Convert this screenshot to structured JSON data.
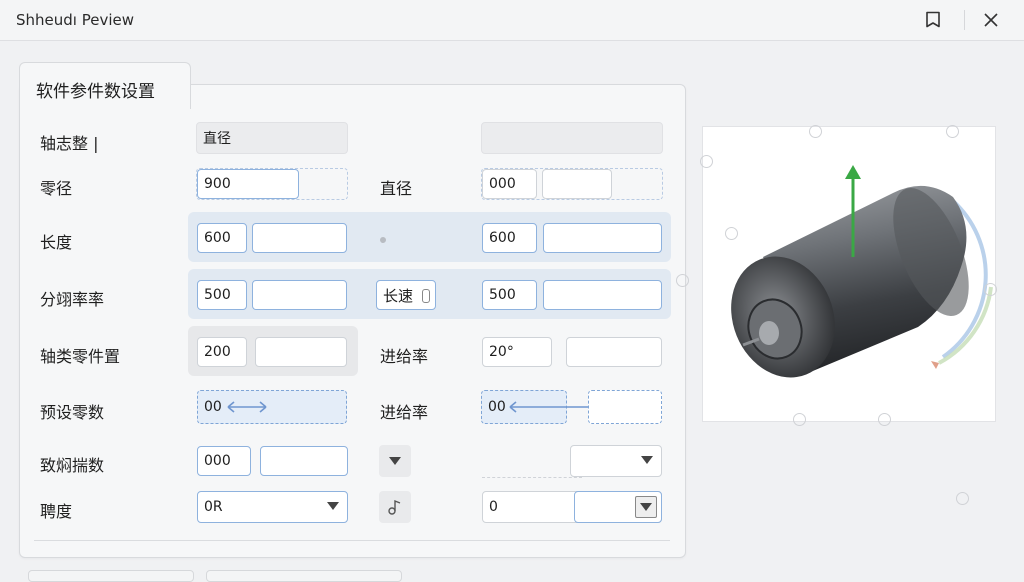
{
  "window": {
    "title": "Shheudı Peview"
  },
  "tab": {
    "label": "软件参件数设置"
  },
  "rows": {
    "r1": {
      "label": "轴志整 |",
      "value": "直径",
      "right_value": ""
    },
    "r2": {
      "label": "零径",
      "value": "900",
      "mid_label": "直径",
      "right_value": "000"
    },
    "r3": {
      "label": "长度",
      "value": "600",
      "right_value": "600"
    },
    "r4": {
      "label": "分翊率率",
      "value": "500",
      "mid_label": "长速",
      "right_value": "500"
    },
    "r5": {
      "label": "轴类零件置",
      "value": "200",
      "mid_label": "进给率",
      "right_value": "20°"
    },
    "r6": {
      "label": "预设零数",
      "value": "00",
      "mid_label": "进给率",
      "right_value": "00"
    },
    "r7": {
      "label": "致焖揣数",
      "value": "000",
      "right_value": ""
    },
    "r8": {
      "label": "聘度",
      "value": "0R",
      "right_value": "0"
    }
  },
  "icons": {
    "bookmark": "bookmark-icon",
    "close": "close-icon",
    "dropdown": "chevron-down-icon",
    "music": "music-note-icon"
  },
  "colors": {
    "accent": "#8eb2de",
    "axis_arrow": "#3aa845"
  }
}
